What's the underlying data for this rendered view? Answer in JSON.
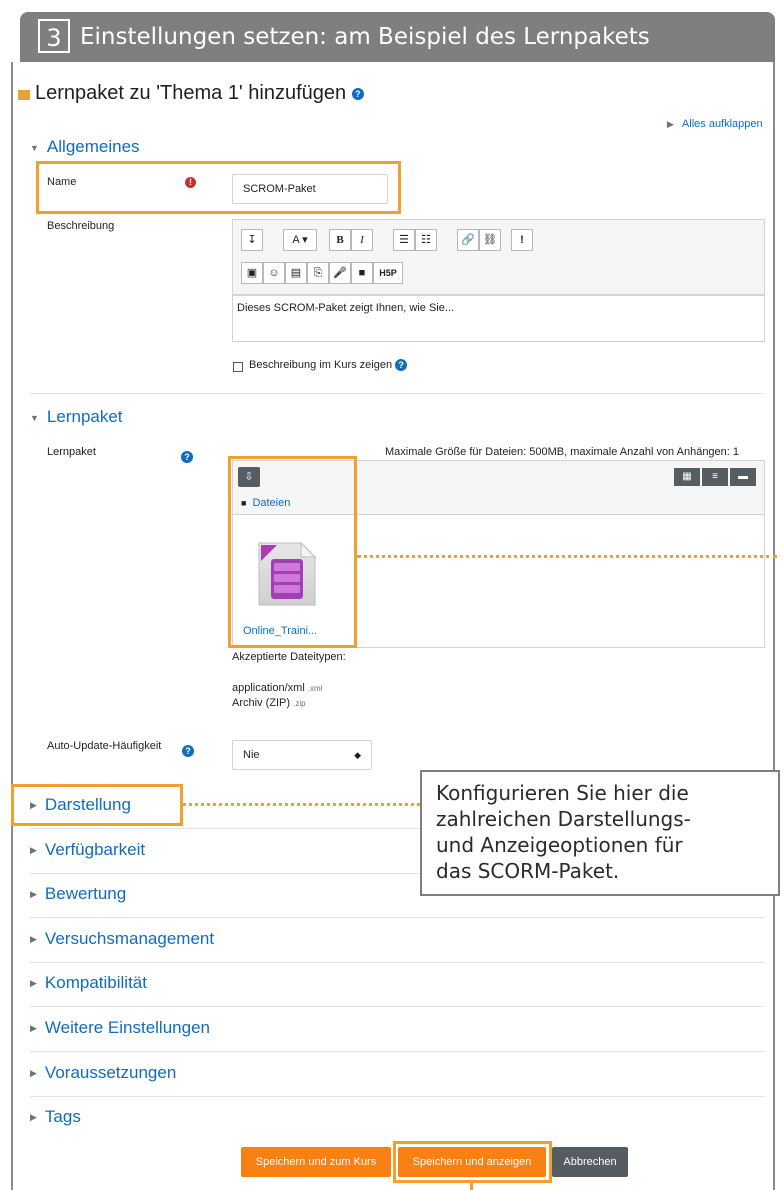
{
  "step": {
    "number": "3",
    "title": "Einstellungen setzen: am Beispiel des Lernpakets"
  },
  "page": {
    "title": "Lernpaket zu 'Thema 1' hinzufügen",
    "expand_all": "Alles aufklappen"
  },
  "general": {
    "heading": "Allgemeines",
    "name_label": "Name",
    "name_value": "SCROM-Paket",
    "description_label": "Beschreibung",
    "description_text": "Dieses SCROM-Paket zeigt Ihnen, wie Sie...",
    "show_description_label": "Beschreibung im Kurs zeigen",
    "toolbar_row1": [
      "↧",
      "A ▾",
      "B",
      "I",
      "☰",
      "☷",
      "🔗",
      "⛓",
      "!"
    ],
    "toolbar_row2": [
      "▣",
      "☺",
      "▤",
      "⎘",
      "🎤",
      "■",
      "H5P"
    ]
  },
  "package": {
    "heading": "Lernpaket",
    "label": "Lernpaket",
    "limits": "Maximale Größe für Dateien: 500MB, maximale Anzahl von Anhängen: 1",
    "folder": "Dateien",
    "file_name": "Online_Traini...",
    "accepted_label": "Akzeptierte Dateitypen:",
    "types": [
      {
        "name": "application/xml",
        "ext": ".xml"
      },
      {
        "name": "Archiv (ZIP)",
        "ext": ".zip"
      }
    ],
    "auto_update_label": "Auto-Update-Häufigkeit",
    "auto_update_value": "Nie"
  },
  "sections": [
    "Darstellung",
    "Verfügbarkeit",
    "Bewertung",
    "Versuchsmanagement",
    "Kompatibilität",
    "Weitere Einstellungen",
    "Voraussetzungen",
    "Tags"
  ],
  "buttons": {
    "save_course": "Speichern und zum Kurs",
    "save_show": "Speichern und anzeigen",
    "cancel": "Abbrechen"
  },
  "callout": {
    "lines": [
      "Konfigurieren Sie hier die",
      "zahlreichen Darstellungs-",
      "und Anzeigeoptionen für",
      "das SCORM-Paket."
    ]
  },
  "colors": {
    "highlight": "#f0a02c",
    "header_bg": "#7f7f81",
    "link": "#0f6cbf",
    "primary_button": "#f98012",
    "cancel_button": "#555c62"
  }
}
